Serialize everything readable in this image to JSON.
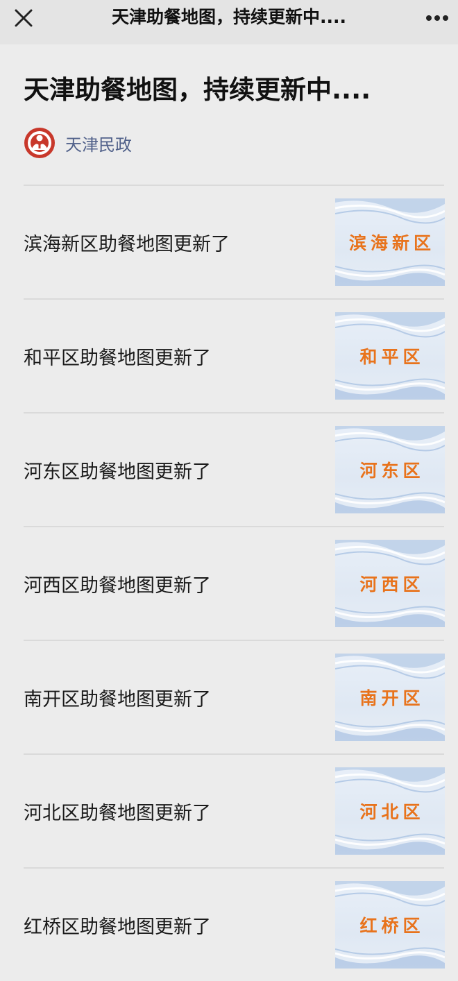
{
  "topbar": {
    "title": "天津助餐地图，持续更新中...."
  },
  "article": {
    "title": "天津助餐地图，持续更新中....",
    "account_name": "天津民政"
  },
  "items": [
    {
      "label": "滨海新区助餐地图更新了",
      "thumb_text": "滨海新区"
    },
    {
      "label": "和平区助餐地图更新了",
      "thumb_text": "和平区"
    },
    {
      "label": "河东区助餐地图更新了",
      "thumb_text": "河东区"
    },
    {
      "label": "河西区助餐地图更新了",
      "thumb_text": "河西区"
    },
    {
      "label": "南开区助餐地图更新了",
      "thumb_text": "南开区"
    },
    {
      "label": "河北区助餐地图更新了",
      "thumb_text": "河北区"
    },
    {
      "label": "红桥区助餐地图更新了",
      "thumb_text": "红桥区"
    }
  ],
  "colors": {
    "accent_orange": "#e8731c",
    "account_blue": "#51618a",
    "avatar_red": "#c8382b"
  },
  "icons": {
    "close": "close-icon",
    "more": "more-icon",
    "avatar": "civil-affairs-emblem-icon"
  }
}
